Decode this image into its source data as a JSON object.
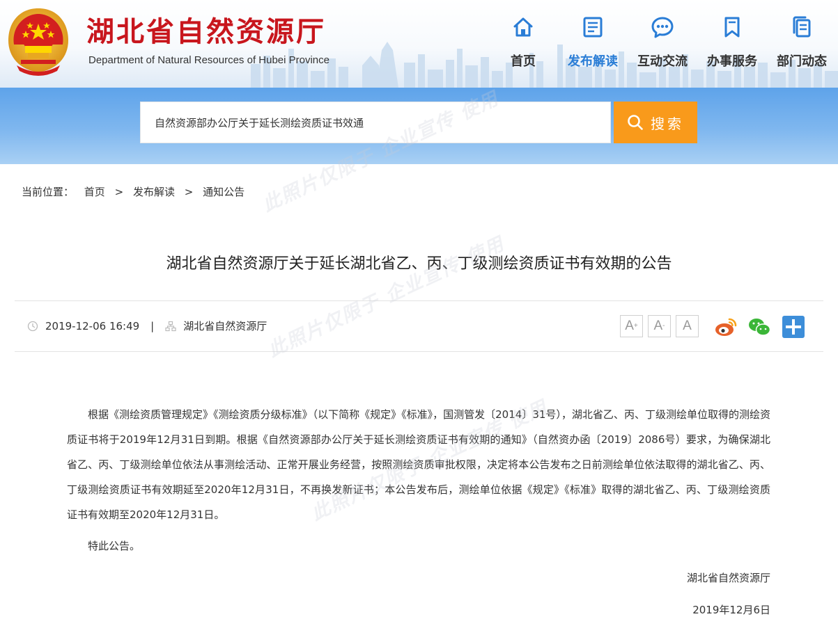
{
  "header": {
    "title": "湖北省自然资源厅",
    "subtitle": "Department of Natural Resources of Hubei Province"
  },
  "nav": [
    {
      "label": "首页",
      "icon": "home-icon",
      "active": false
    },
    {
      "label": "发布解读",
      "icon": "document-icon",
      "active": true
    },
    {
      "label": "互动交流",
      "icon": "chat-bubble-icon",
      "active": false
    },
    {
      "label": "办事服务",
      "icon": "bookmark-icon",
      "active": false
    },
    {
      "label": "部门动态",
      "icon": "copy-pages-icon",
      "active": false
    }
  ],
  "search": {
    "value": "自然资源部办公厅关于延长测绘资质证书效通",
    "button_label": "搜索"
  },
  "breadcrumb": {
    "label": "当前位置：",
    "items": [
      "首页",
      "发布解读",
      "通知公告"
    ],
    "separator": ">"
  },
  "article": {
    "title": "湖北省自然资源厅关于延长湖北省乙、丙、丁级测绘资质证书有效期的公告",
    "datetime": "2019-12-06 16:49",
    "meta_divider": "|",
    "source": "湖北省自然资源厅",
    "font_buttons": [
      "A",
      "A",
      "A"
    ],
    "font_button_marks": [
      "+",
      "-"
    ],
    "paragraph": "根据《测绘资质管理规定》《测绘资质分级标准》（以下简称《规定》《标准》，国测管发〔2014〕31号），湖北省乙、丙、丁级测绘单位取得的测绘资质证书将于2019年12月31日到期。根据《自然资源部办公厅关于延长测绘资质证书有效期的通知》（自然资办函〔2019〕2086号）要求，为确保湖北省乙、丙、丁级测绘单位依法从事测绘活动、正常开展业务经营，按照测绘资质审批权限，决定将本公告发布之日前测绘单位依法取得的湖北省乙、丙、丁级测绘资质证书有效期延至2020年12月31日，不再换发新证书；本公告发布后，测绘单位依据《规定》《标准》取得的湖北省乙、丙、丁级测绘资质证书有效期至2020年12月31日。",
    "closing": "特此公告。",
    "signature": "湖北省自然资源厅",
    "sign_date": "2019年12月6日"
  },
  "share": [
    "weibo-icon",
    "wechat-icon",
    "more-share-icon"
  ],
  "watermark": "此照片仅限于 企业宣传 使用",
  "colors": {
    "brand_red": "#c8161d",
    "accent_blue": "#2a7dd6",
    "search_orange": "#f99a1b",
    "band_blue": "#6aaceb",
    "weibo_orange": "#e6612a",
    "wechat_green": "#3bb638",
    "share_blue": "#3d8ed9"
  }
}
